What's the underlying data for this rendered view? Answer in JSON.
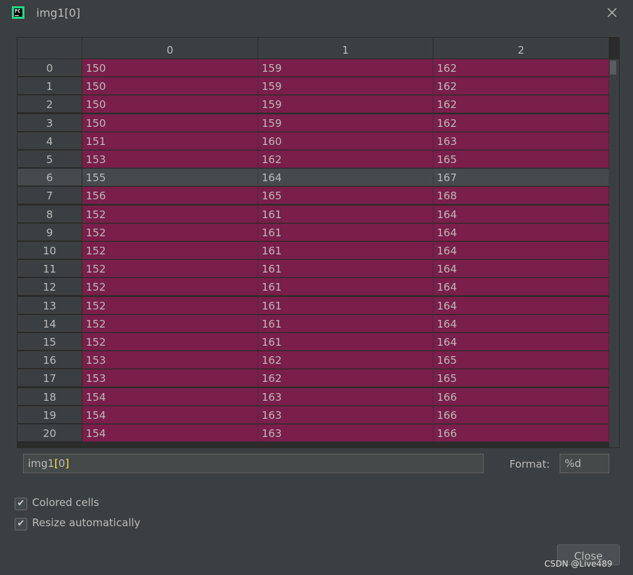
{
  "window": {
    "title": "img1[0]",
    "app_icon_text": "PC"
  },
  "table": {
    "columns": [
      "0",
      "1",
      "2"
    ],
    "selected_row": 6,
    "rows": [
      {
        "index": "0",
        "values": [
          "150",
          "159",
          "162"
        ]
      },
      {
        "index": "1",
        "values": [
          "150",
          "159",
          "162"
        ]
      },
      {
        "index": "2",
        "values": [
          "150",
          "159",
          "162"
        ]
      },
      {
        "index": "3",
        "values": [
          "150",
          "159",
          "162"
        ]
      },
      {
        "index": "4",
        "values": [
          "151",
          "160",
          "163"
        ]
      },
      {
        "index": "5",
        "values": [
          "153",
          "162",
          "165"
        ]
      },
      {
        "index": "6",
        "values": [
          "155",
          "164",
          "167"
        ]
      },
      {
        "index": "7",
        "values": [
          "156",
          "165",
          "168"
        ]
      },
      {
        "index": "8",
        "values": [
          "152",
          "161",
          "164"
        ]
      },
      {
        "index": "9",
        "values": [
          "152",
          "161",
          "164"
        ]
      },
      {
        "index": "10",
        "values": [
          "152",
          "161",
          "164"
        ]
      },
      {
        "index": "11",
        "values": [
          "152",
          "161",
          "164"
        ]
      },
      {
        "index": "12",
        "values": [
          "152",
          "161",
          "164"
        ]
      },
      {
        "index": "13",
        "values": [
          "152",
          "161",
          "164"
        ]
      },
      {
        "index": "14",
        "values": [
          "152",
          "161",
          "164"
        ]
      },
      {
        "index": "15",
        "values": [
          "152",
          "161",
          "164"
        ]
      },
      {
        "index": "16",
        "values": [
          "153",
          "162",
          "165"
        ]
      },
      {
        "index": "17",
        "values": [
          "153",
          "162",
          "165"
        ]
      },
      {
        "index": "18",
        "values": [
          "154",
          "163",
          "166"
        ]
      },
      {
        "index": "19",
        "values": [
          "154",
          "163",
          "166"
        ]
      },
      {
        "index": "20",
        "values": [
          "154",
          "163",
          "166"
        ]
      }
    ],
    "cell_color": "#7a1e4a",
    "selected_color": "#464a4d"
  },
  "expression": {
    "prefix": "img1",
    "open_bracket": "[",
    "index": "0",
    "close_bracket": "]"
  },
  "format": {
    "label": "Format:",
    "value": "%d"
  },
  "options": [
    {
      "label": "Colored cells",
      "checked": true
    },
    {
      "label": "Resize automatically",
      "checked": true
    }
  ],
  "buttons": {
    "close_label": "Close"
  },
  "icons": {
    "close": "close-icon",
    "checkbox": "checkmark-icon"
  },
  "watermark": "CSDN @Live489"
}
